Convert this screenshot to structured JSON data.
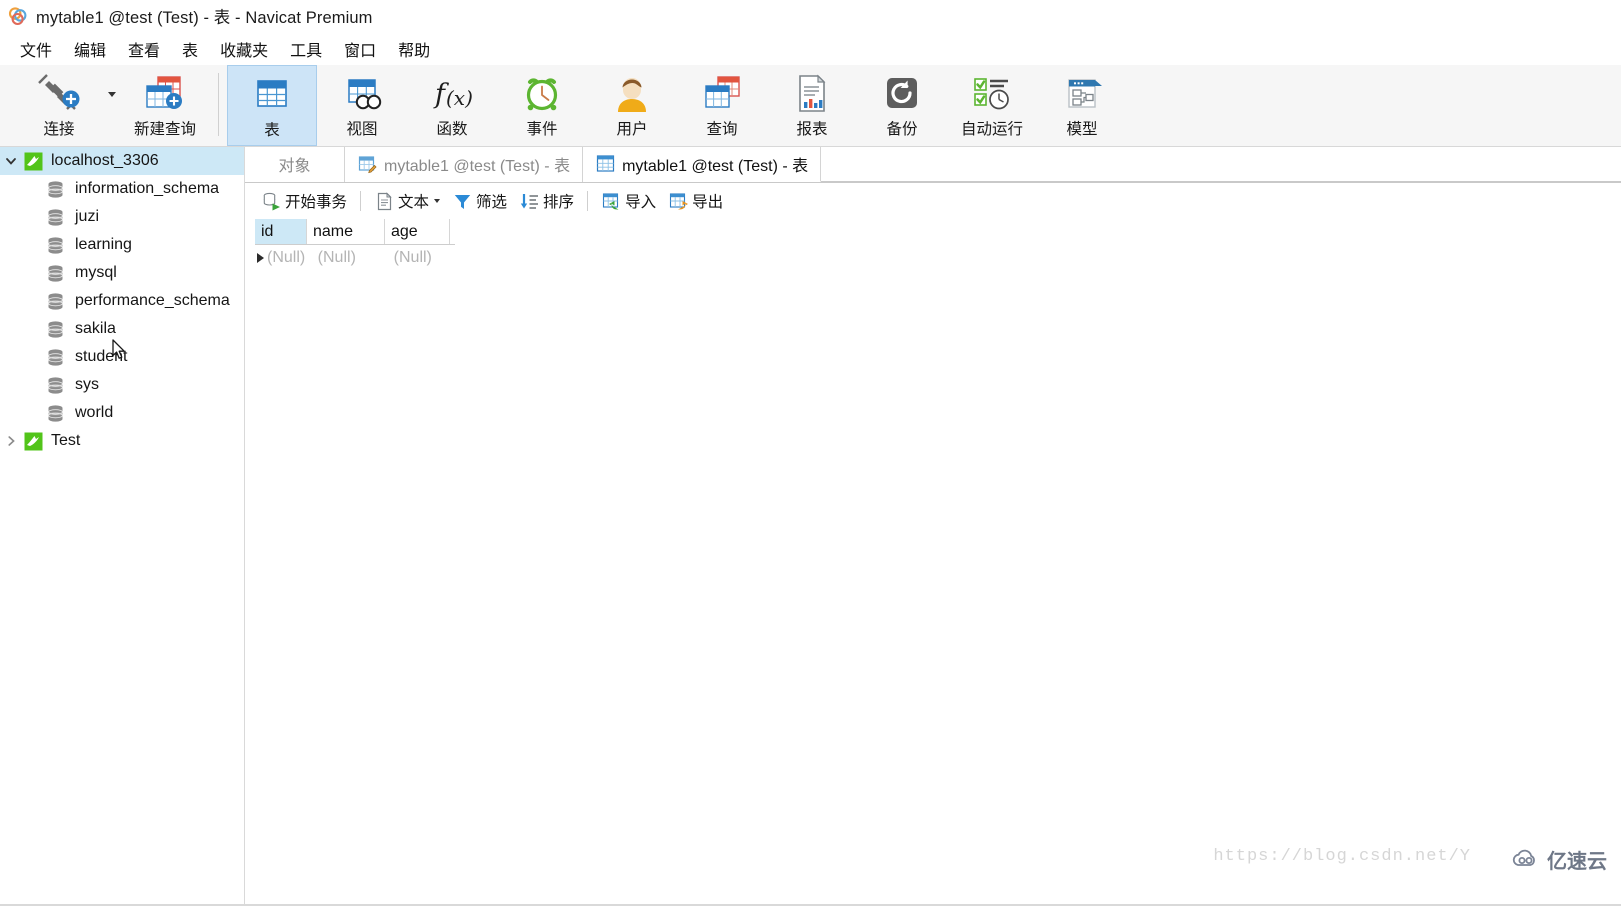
{
  "window": {
    "title": "mytable1 @test (Test) - 表 - Navicat Premium",
    "logo_icon": "navicat-logo-icon"
  },
  "menubar": {
    "items": [
      {
        "label": "文件",
        "name": "menu-file"
      },
      {
        "label": "编辑",
        "name": "menu-edit"
      },
      {
        "label": "查看",
        "name": "menu-view"
      },
      {
        "label": "表",
        "name": "menu-table"
      },
      {
        "label": "收藏夹",
        "name": "menu-favorites"
      },
      {
        "label": "工具",
        "name": "menu-tools"
      },
      {
        "label": "窗口",
        "name": "menu-window"
      },
      {
        "label": "帮助",
        "name": "menu-help"
      }
    ]
  },
  "toolbar": {
    "buttons": [
      {
        "label": "连接",
        "icon": "connection-plug-icon",
        "active": false
      },
      {
        "label": "新建查询",
        "icon": "new-query-icon",
        "active": false
      },
      {
        "label": "表",
        "icon": "table-icon",
        "active": true
      },
      {
        "label": "视图",
        "icon": "view-icon",
        "active": false
      },
      {
        "label": "函数",
        "icon": "function-fx-icon",
        "active": false
      },
      {
        "label": "事件",
        "icon": "event-clock-icon",
        "active": false
      },
      {
        "label": "用户",
        "icon": "user-icon",
        "active": false
      },
      {
        "label": "查询",
        "icon": "query-icon",
        "active": false
      },
      {
        "label": "报表",
        "icon": "report-icon",
        "active": false
      },
      {
        "label": "备份",
        "icon": "backup-icon",
        "active": false
      },
      {
        "label": "自动运行",
        "icon": "automation-icon",
        "active": false
      },
      {
        "label": "模型",
        "icon": "model-icon",
        "active": false
      }
    ]
  },
  "sidebar": {
    "connections": [
      {
        "label": "localhost_3306",
        "icon": "mysql-connection-icon",
        "expanded": true,
        "selected": true,
        "databases": [
          {
            "label": "information_schema",
            "icon": "database-icon"
          },
          {
            "label": "juzi",
            "icon": "database-icon"
          },
          {
            "label": "learning",
            "icon": "database-icon"
          },
          {
            "label": "mysql",
            "icon": "database-icon"
          },
          {
            "label": "performance_schema",
            "icon": "database-icon"
          },
          {
            "label": "sakila",
            "icon": "database-icon"
          },
          {
            "label": "student",
            "icon": "database-icon"
          },
          {
            "label": "sys",
            "icon": "database-icon"
          },
          {
            "label": "world",
            "icon": "database-icon"
          }
        ]
      },
      {
        "label": "Test",
        "icon": "mysql-connection-icon",
        "expanded": false,
        "selected": false,
        "databases": []
      }
    ]
  },
  "tabs": [
    {
      "label": "对象",
      "icon": "",
      "active": false,
      "name": "tab-objects"
    },
    {
      "label": "mytable1 @test (Test) - 表",
      "icon": "table-designer-icon",
      "active": false,
      "name": "tab-table-designer"
    },
    {
      "label": "mytable1 @test (Test) - 表",
      "icon": "table-data-icon",
      "active": true,
      "name": "tab-table-data"
    }
  ],
  "gridbar": {
    "buttons": [
      {
        "label": "开始事务",
        "icon": "begin-transaction-icon",
        "caret": false,
        "name": "begin-transaction-button"
      },
      {
        "label": "文本",
        "icon": "text-document-icon",
        "caret": true,
        "name": "text-button"
      },
      {
        "label": "筛选",
        "icon": "filter-funnel-icon",
        "caret": false,
        "name": "filter-button"
      },
      {
        "label": "排序",
        "icon": "sort-icon",
        "caret": false,
        "name": "sort-button"
      },
      {
        "label": "导入",
        "icon": "import-icon",
        "caret": false,
        "name": "import-button"
      },
      {
        "label": "导出",
        "icon": "export-icon",
        "caret": false,
        "name": "export-button"
      }
    ]
  },
  "grid": {
    "columns": [
      "id",
      "name",
      "age"
    ],
    "selected_column": "id",
    "rows": [
      {
        "current": true,
        "cells": [
          "(Null)",
          "(Null)",
          "(Null)"
        ]
      }
    ]
  },
  "watermark": {
    "url": "https://blog.csdn.net/Y",
    "badge": "亿速云"
  },
  "colors": {
    "accent_blue": "#2b7cc3",
    "selection_blue": "#cde8f6",
    "toolbar_bg": "#f6f6f6",
    "null_gray": "#b4b4b4"
  }
}
